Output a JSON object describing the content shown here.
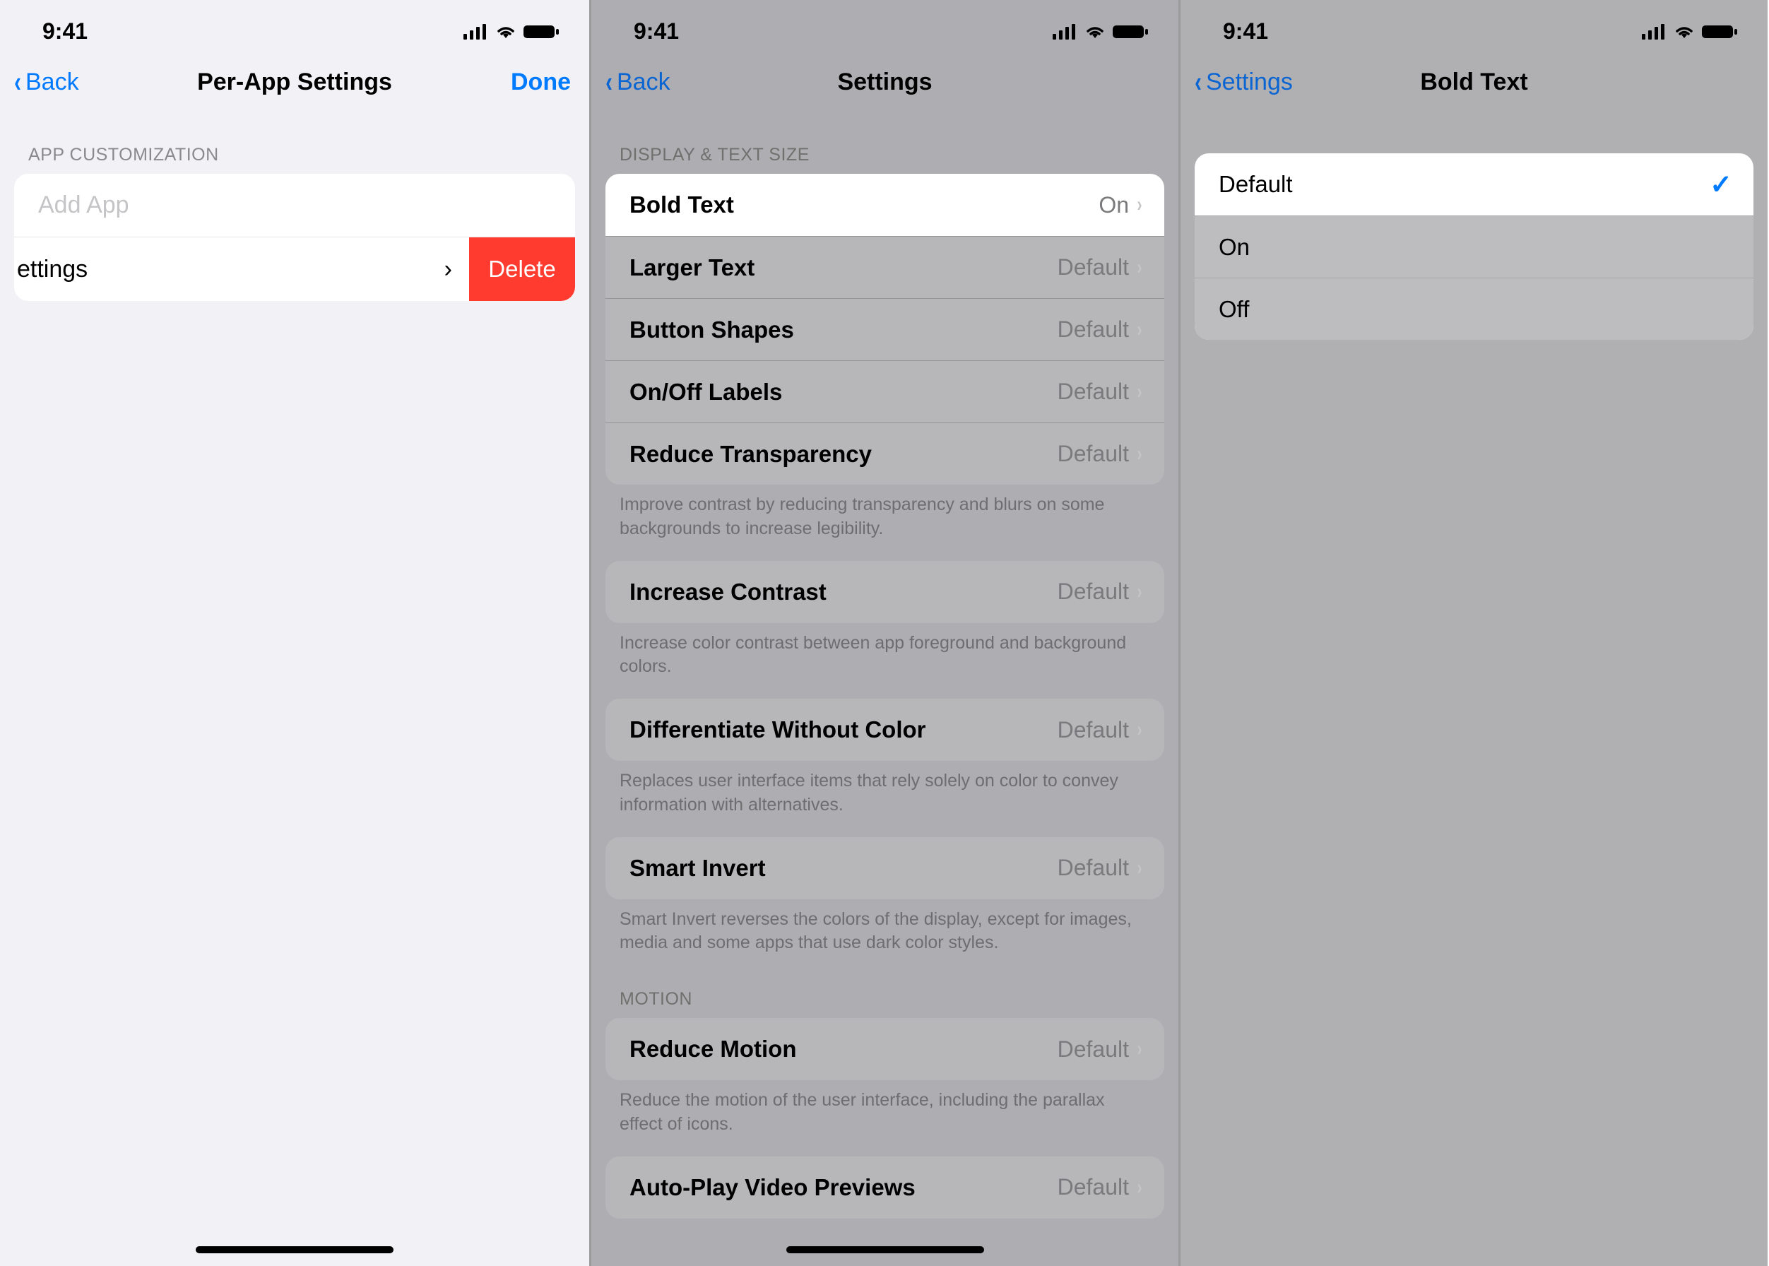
{
  "status": {
    "time": "9:41"
  },
  "screen1": {
    "back": "Back",
    "title": "Per-App Settings",
    "done": "Done",
    "section_header": "APP CUSTOMIZATION",
    "add_placeholder": "Add App",
    "swiped_label": "ettings",
    "delete": "Delete"
  },
  "screen2": {
    "back": "Back",
    "title": "Settings",
    "section_display": "DISPLAY & TEXT SIZE",
    "rows_display": [
      {
        "label": "Bold Text",
        "value": "On"
      },
      {
        "label": "Larger Text",
        "value": "Default"
      },
      {
        "label": "Button Shapes",
        "value": "Default"
      },
      {
        "label": "On/Off Labels",
        "value": "Default"
      },
      {
        "label": "Reduce Transparency",
        "value": "Default"
      }
    ],
    "note_display": "Improve contrast by reducing transparency and blurs on some backgrounds to increase legibility.",
    "row_contrast": {
      "label": "Increase Contrast",
      "value": "Default"
    },
    "note_contrast": "Increase color contrast between app foreground and background colors.",
    "row_diff": {
      "label": "Differentiate Without Color",
      "value": "Default"
    },
    "note_diff": "Replaces user interface items that rely solely on color to convey information with alternatives.",
    "row_invert": {
      "label": "Smart Invert",
      "value": "Default"
    },
    "note_invert": "Smart Invert reverses the colors of the display, except for images, media and some apps that use dark color styles.",
    "section_motion": "MOTION",
    "row_motion": {
      "label": "Reduce Motion",
      "value": "Default"
    },
    "note_motion": "Reduce the motion of the user interface, including the parallax effect of icons.",
    "row_autoplay": {
      "label": "Auto-Play Video Previews",
      "value": "Default"
    }
  },
  "screen3": {
    "back": "Settings",
    "title": "Bold Text",
    "options": [
      "Default",
      "On",
      "Off"
    ],
    "selected": 0
  }
}
